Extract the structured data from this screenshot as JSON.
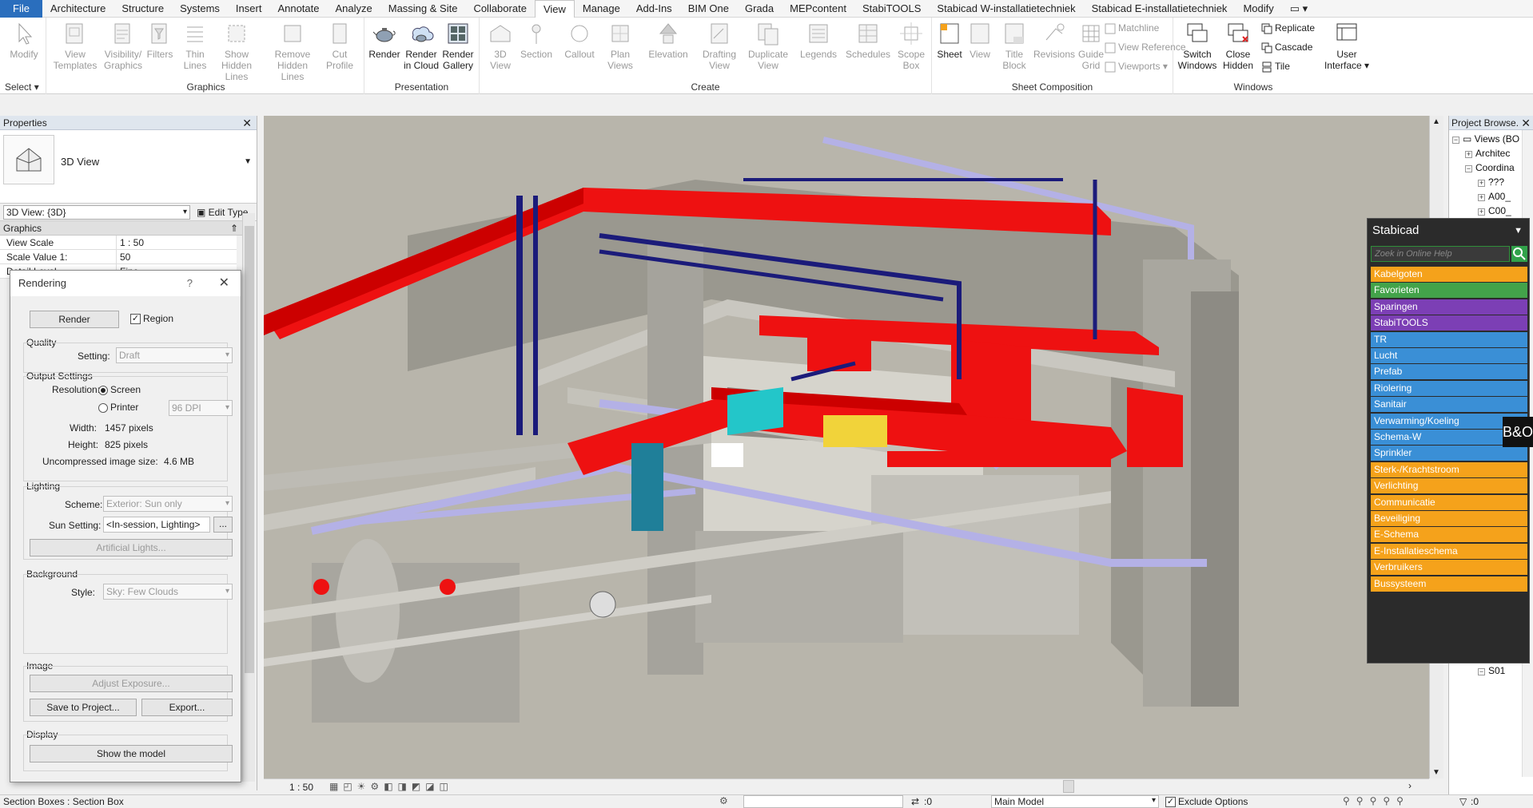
{
  "menu_tabs": [
    "File",
    "Architecture",
    "Structure",
    "Systems",
    "Insert",
    "Annotate",
    "Analyze",
    "Massing & Site",
    "Collaborate",
    "View",
    "Manage",
    "Add-Ins",
    "BIM One",
    "Grada",
    "MEPcontent",
    "StabiTOOLS",
    "Stabicad W-installatietechniek",
    "Stabicad E-installatietechniek",
    "Modify"
  ],
  "active_tab": "View",
  "ribbon": {
    "select": {
      "modify": "Modify",
      "label": "Select"
    },
    "graphics": {
      "label": "Graphics",
      "view_templates": "View Templates",
      "visibility_graphics": "Visibility/ Graphics",
      "filters": "Filters",
      "thin_lines": "Thin Lines",
      "show_hidden_lines": "Show Hidden Lines",
      "remove_hidden_lines": "Remove Hidden Lines",
      "cut_profile": "Cut Profile"
    },
    "presentation": {
      "label": "Presentation",
      "render": "Render",
      "render_in_cloud": "Render in Cloud",
      "render_gallery": "Render Gallery"
    },
    "create": {
      "label": "Create",
      "view_3d": "3D View",
      "section": "Section",
      "callout": "Callout",
      "plan_views": "Plan Views",
      "elevation": "Elevation",
      "drafting_view": "Drafting View",
      "duplicate_view": "Duplicate View",
      "legends": "Legends",
      "schedules": "Schedules",
      "scope_box": "Scope Box"
    },
    "sheet_composition": {
      "label": "Sheet Composition",
      "sheet": "Sheet",
      "view": "View",
      "title_block": "Title Block",
      "revisions": "Revisions",
      "guide_grid": "Guide Grid",
      "matchline": "Matchline",
      "view_reference": "View Reference",
      "viewports": "Viewports"
    },
    "windows": {
      "label": "Windows",
      "switch_windows": "Switch Windows",
      "close_hidden": "Close Hidden",
      "replicate": "Replicate",
      "cascade": "Cascade",
      "tile": "Tile",
      "user_interface": "User Interface"
    }
  },
  "properties": {
    "title": "Properties",
    "type_name": "3D View",
    "view_selector": "3D View: {3D}",
    "edit_type": "Edit Type",
    "section": "Graphics",
    "rows": [
      {
        "k": "View Scale",
        "v": "1 : 50"
      },
      {
        "k": "Scale Value    1:",
        "v": "50"
      },
      {
        "k": "Detail Level",
        "v": "Fine"
      }
    ]
  },
  "rendering": {
    "title": "Rendering",
    "help": "?",
    "render_button": "Render",
    "region_label": "Region",
    "quality": {
      "label": "Quality",
      "setting_label": "Setting:",
      "setting_value": "Draft"
    },
    "output": {
      "label": "Output Settings",
      "resolution_label": "Resolution:",
      "screen": "Screen",
      "printer": "Printer",
      "dpi": "96 DPI",
      "width_label": "Width:",
      "width_value": "1457 pixels",
      "height_label": "Height:",
      "height_value": "825 pixels",
      "size_label": "Uncompressed image size:",
      "size_value": "4.6 MB"
    },
    "lighting": {
      "label": "Lighting",
      "scheme_label": "Scheme:",
      "scheme_value": "Exterior: Sun only",
      "sun_label": "Sun Setting:",
      "sun_value": "<In-session, Lighting>",
      "sun_more": "...",
      "artificial": "Artificial Lights..."
    },
    "background": {
      "label": "Background",
      "style_label": "Style:",
      "style_value": "Sky: Few Clouds"
    },
    "image": {
      "label": "Image",
      "adjust": "Adjust Exposure...",
      "save": "Save to Project...",
      "export": "Export..."
    },
    "display": {
      "label": "Display",
      "show": "Show the model"
    }
  },
  "view_status": {
    "scale": "1 : 50"
  },
  "project_browser": {
    "title": "Project Browse...",
    "nodes": [
      {
        "label": "Views (BO",
        "box": "−"
      },
      {
        "label": "Architec",
        "box": "+"
      },
      {
        "label": "Coordina",
        "box": "−"
      },
      {
        "label": "???",
        "box": "+"
      },
      {
        "label": "A00_",
        "box": "+"
      },
      {
        "label": "C00_",
        "box": "+"
      },
      {
        "label": "S01",
        "box": "−"
      }
    ]
  },
  "stabicad": {
    "title": "Stabicad",
    "search_placeholder": "Zoek in Online Help",
    "items": [
      {
        "label": "Kabelgoten",
        "color": "#f5a21b"
      },
      {
        "label": "Favorieten",
        "color": "#43a34a"
      },
      {
        "label": "Sparingen",
        "color": "#7c3fb5"
      },
      {
        "label": "StabiTOOLS",
        "color": "#7c3fb5"
      },
      {
        "label": "TR",
        "color": "#3a8fd6"
      },
      {
        "label": "Lucht",
        "color": "#3a8fd6"
      },
      {
        "label": "Prefab",
        "color": "#3a8fd6"
      },
      {
        "label": "Riolering",
        "color": "#3a8fd6"
      },
      {
        "label": "Sanitair",
        "color": "#3a8fd6"
      },
      {
        "label": "Verwarming/Koeling",
        "color": "#3a8fd6"
      },
      {
        "label": "Schema-W",
        "color": "#3a8fd6"
      },
      {
        "label": "Sprinkler",
        "color": "#3a8fd6"
      },
      {
        "label": "Sterk-/Krachtstroom",
        "color": "#f5a21b"
      },
      {
        "label": "Verlichting",
        "color": "#f5a21b"
      },
      {
        "label": "Communicatie",
        "color": "#f5a21b"
      },
      {
        "label": "Beveiliging",
        "color": "#f5a21b"
      },
      {
        "label": "E-Schema",
        "color": "#f5a21b"
      },
      {
        "label": "E-Installatieschema",
        "color": "#f5a21b"
      },
      {
        "label": "Verbruikers",
        "color": "#f5a21b"
      },
      {
        "label": "Bussysteem",
        "color": "#f5a21b"
      }
    ]
  },
  "bo_logo": "B&O",
  "status_bar": {
    "message": "Section Boxes : Section Box",
    "workset_count": ":0",
    "model": "Main Model",
    "exclude_options": "Exclude Options",
    "filter_count": ":0"
  }
}
